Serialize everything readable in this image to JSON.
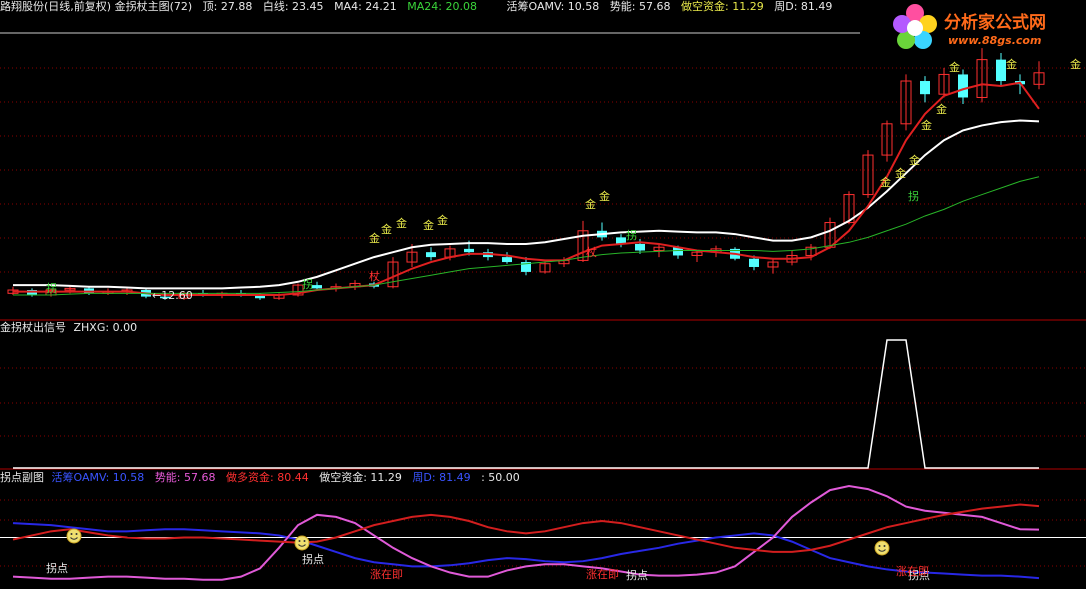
{
  "main_header": {
    "title": "路翔股份(日线,前复权) 金拐杖主图(72)",
    "top": "顶: 27.88",
    "white_line": "白线: 23.45",
    "ma4": "MA4: 24.21",
    "ma24": "MA24: 20.08",
    "oamv": "活筹OAMV: 10.58",
    "momentum": "势能: 57.68",
    "short_fund": "做空资金: 11.29",
    "weekD": "周D: 81.49"
  },
  "signal_header": {
    "title": "金拐杖出信号",
    "zhxg": "ZHXG: 0.00"
  },
  "sub_header": {
    "title": "拐点副图",
    "oamv": "活筹OAMV: 10.58",
    "momentum": "势能: 57.68",
    "long_fund": "做多资金: 80.44",
    "short_fund": "做空资金: 11.29",
    "weekD": "周D: 81.49",
    "level": ": 50.00"
  },
  "logo": {
    "name": "分析家公式网",
    "url": "www.88gs.com"
  },
  "annotations": {
    "low_price": "←12.60",
    "gold": "金",
    "crutch": "拐",
    "crutch2": "杖",
    "turn_point": "拐点",
    "rise_soon": "涨在即"
  },
  "colors": {
    "up": "#ff3030",
    "down": "#54ffff",
    "white_line": "#ffffff",
    "ma4": "#e02020",
    "ma24": "#28b428",
    "oamv": "#2828e6",
    "momentum": "#e05ad8",
    "long_fund": "#d21e1e",
    "grid": "#8a0000"
  },
  "chart_data": [
    {
      "type": "candlestick",
      "title": "路翔股份(日线,前复权) 金拐杖主图(72)",
      "ylim": [
        11.5,
        29
      ],
      "ohlc": [
        [
          13.0,
          13.4,
          12.9,
          13.2
        ],
        [
          13.2,
          13.3,
          12.8,
          12.9
        ],
        [
          12.9,
          13.3,
          12.8,
          13.2
        ],
        [
          13.2,
          13.5,
          13.0,
          13.3
        ],
        [
          13.3,
          13.4,
          12.9,
          13.0
        ],
        [
          13.0,
          13.3,
          12.9,
          13.1
        ],
        [
          13.1,
          13.4,
          12.9,
          13.2
        ],
        [
          13.2,
          13.3,
          12.7,
          12.8
        ],
        [
          12.8,
          13.0,
          12.6,
          12.7
        ],
        [
          12.7,
          13.1,
          12.6,
          13.0
        ],
        [
          13.0,
          13.2,
          12.8,
          12.9
        ],
        [
          12.9,
          13.1,
          12.7,
          13.0
        ],
        [
          13.0,
          13.2,
          12.8,
          12.9
        ],
        [
          12.9,
          13.0,
          12.6,
          12.7
        ],
        [
          12.7,
          13.0,
          12.6,
          12.9
        ],
        [
          12.9,
          13.6,
          12.8,
          13.5
        ],
        [
          13.5,
          13.7,
          13.2,
          13.3
        ],
        [
          13.3,
          13.6,
          13.1,
          13.4
        ],
        [
          13.4,
          13.8,
          13.2,
          13.6
        ],
        [
          13.6,
          13.7,
          13.3,
          13.4
        ],
        [
          13.4,
          15.2,
          13.3,
          14.9
        ],
        [
          14.9,
          16.0,
          14.6,
          15.5
        ],
        [
          15.5,
          15.8,
          15.0,
          15.2
        ],
        [
          15.2,
          15.9,
          15.0,
          15.7
        ],
        [
          15.7,
          16.2,
          15.3,
          15.5
        ],
        [
          15.5,
          15.7,
          15.0,
          15.2
        ],
        [
          15.2,
          15.5,
          14.8,
          14.9
        ],
        [
          14.9,
          15.2,
          14.1,
          14.3
        ],
        [
          14.3,
          14.9,
          14.2,
          14.8
        ],
        [
          14.8,
          15.2,
          14.6,
          15.0
        ],
        [
          15.0,
          17.4,
          14.9,
          16.8
        ],
        [
          16.8,
          17.3,
          16.2,
          16.4
        ],
        [
          16.4,
          16.6,
          15.8,
          16.0
        ],
        [
          16.0,
          16.3,
          15.4,
          15.6
        ],
        [
          15.6,
          16.0,
          15.2,
          15.8
        ],
        [
          15.8,
          15.9,
          15.1,
          15.3
        ],
        [
          15.3,
          15.6,
          14.9,
          15.5
        ],
        [
          15.5,
          15.9,
          15.2,
          15.7
        ],
        [
          15.7,
          15.8,
          15.0,
          15.1
        ],
        [
          15.1,
          15.3,
          14.4,
          14.6
        ],
        [
          14.6,
          15.1,
          14.2,
          14.9
        ],
        [
          14.9,
          15.6,
          14.7,
          15.3
        ],
        [
          15.3,
          16.0,
          15.0,
          15.8
        ],
        [
          15.8,
          17.6,
          15.7,
          17.3
        ],
        [
          17.3,
          19.2,
          17.2,
          19.0
        ],
        [
          19.0,
          21.7,
          18.8,
          21.4
        ],
        [
          21.4,
          23.5,
          21.0,
          23.3
        ],
        [
          23.3,
          26.3,
          22.9,
          25.9
        ],
        [
          25.9,
          26.2,
          24.6,
          25.1
        ],
        [
          25.1,
          26.7,
          24.9,
          26.3
        ],
        [
          26.3,
          26.6,
          24.5,
          24.9
        ],
        [
          24.9,
          27.9,
          24.6,
          27.2
        ],
        [
          27.2,
          27.6,
          25.6,
          25.9
        ],
        [
          25.9,
          26.3,
          25.1,
          25.7
        ],
        [
          25.7,
          27.1,
          25.4,
          26.4
        ]
      ],
      "series": [
        {
          "name": "白线",
          "values": [
            13.5,
            13.5,
            13.5,
            13.45,
            13.4,
            13.4,
            13.35,
            13.3,
            13.3,
            13.3,
            13.3,
            13.3,
            13.35,
            13.4,
            13.5,
            13.7,
            14.0,
            14.4,
            14.8,
            15.2,
            15.5,
            15.8,
            15.95,
            16.0,
            16.05,
            16.05,
            16.0,
            16.0,
            16.1,
            16.3,
            16.5,
            16.6,
            16.7,
            16.75,
            16.8,
            16.75,
            16.7,
            16.7,
            16.6,
            16.4,
            16.2,
            16.2,
            16.4,
            16.8,
            17.4,
            18.2,
            19.2,
            20.3,
            21.4,
            22.3,
            22.9,
            23.2,
            23.4,
            23.5,
            23.45
          ]
        },
        {
          "name": "MA4",
          "values": [
            13.1,
            13.1,
            13.1,
            13.1,
            13.1,
            13.1,
            13.1,
            13.0,
            12.9,
            12.9,
            12.9,
            12.9,
            12.9,
            12.9,
            12.9,
            13.0,
            13.2,
            13.3,
            13.4,
            13.5,
            14.0,
            14.5,
            14.9,
            15.2,
            15.4,
            15.4,
            15.3,
            15.1,
            15.0,
            15.0,
            15.5,
            15.9,
            16.0,
            16.1,
            16.0,
            15.8,
            15.6,
            15.5,
            15.4,
            15.2,
            15.1,
            15.1,
            15.2,
            15.8,
            16.8,
            18.3,
            20.1,
            22.3,
            23.9,
            25.0,
            25.4,
            25.7,
            25.6,
            25.8,
            24.21
          ]
        },
        {
          "name": "MA24",
          "values": [
            12.9,
            12.9,
            12.9,
            12.95,
            13.0,
            13.0,
            13.0,
            13.0,
            13.0,
            13.0,
            13.0,
            13.0,
            13.0,
            13.0,
            13.05,
            13.1,
            13.2,
            13.3,
            13.4,
            13.5,
            13.7,
            13.9,
            14.1,
            14.3,
            14.5,
            14.6,
            14.7,
            14.8,
            14.9,
            15.0,
            15.2,
            15.35,
            15.45,
            15.5,
            15.55,
            15.6,
            15.6,
            15.6,
            15.6,
            15.6,
            15.55,
            15.6,
            15.7,
            15.9,
            16.1,
            16.4,
            16.8,
            17.2,
            17.7,
            18.1,
            18.6,
            19.0,
            19.4,
            19.8,
            20.08
          ]
        }
      ]
    },
    {
      "type": "line",
      "title": "金拐杖出信号",
      "ylim": [
        0,
        1
      ],
      "series": [
        {
          "name": "ZHXG",
          "values": [
            0,
            0,
            0,
            0,
            0,
            0,
            0,
            0,
            0,
            0,
            0,
            0,
            0,
            0,
            0,
            0,
            0,
            0,
            0,
            0,
            0,
            0,
            0,
            0,
            0,
            0,
            0,
            0,
            0,
            0,
            0,
            0,
            0,
            0,
            0,
            0,
            0,
            0,
            0,
            0,
            0,
            0,
            0,
            0,
            0,
            0,
            1,
            1,
            0,
            0,
            0,
            0,
            0,
            0,
            0
          ]
        }
      ]
    },
    {
      "type": "line",
      "title": "拐点副图",
      "ylim": [
        0,
        100
      ],
      "level": 50,
      "series": [
        {
          "name": "活筹OAMV",
          "values": [
            64,
            63,
            62,
            60,
            58,
            56,
            56,
            57,
            58,
            58,
            57,
            56,
            55,
            54,
            52,
            48,
            42,
            36,
            30,
            26,
            24,
            22,
            22,
            23,
            25,
            28,
            30,
            29,
            27,
            26,
            27,
            30,
            34,
            37,
            40,
            44,
            47,
            50,
            52,
            54,
            52,
            46,
            38,
            30,
            26,
            22,
            19,
            17,
            16,
            15,
            14,
            13,
            13,
            12,
            10.58
          ]
        },
        {
          "name": "势能",
          "values": [
            12,
            11,
            10,
            10,
            11,
            12,
            12,
            11,
            10,
            10,
            9,
            9,
            12,
            20,
            40,
            62,
            72,
            70,
            64,
            52,
            40,
            30,
            22,
            16,
            12,
            12,
            18,
            22,
            24,
            24,
            22,
            20,
            17,
            14,
            13,
            13,
            14,
            16,
            22,
            36,
            50,
            70,
            84,
            96,
            100,
            97,
            90,
            80,
            76,
            74,
            72,
            70,
            64,
            58,
            57.68
          ]
        },
        {
          "name": "做多资金",
          "values": [
            48,
            52,
            56,
            58,
            55,
            52,
            50,
            49,
            49,
            50,
            50,
            49,
            48,
            47,
            46,
            45,
            46,
            50,
            56,
            62,
            66,
            70,
            72,
            70,
            66,
            60,
            56,
            54,
            56,
            60,
            64,
            66,
            64,
            60,
            56,
            52,
            48,
            44,
            40,
            38,
            36,
            36,
            38,
            42,
            48,
            54,
            60,
            64,
            68,
            72,
            75,
            78,
            80,
            82,
            80.44
          ]
        }
      ]
    }
  ]
}
